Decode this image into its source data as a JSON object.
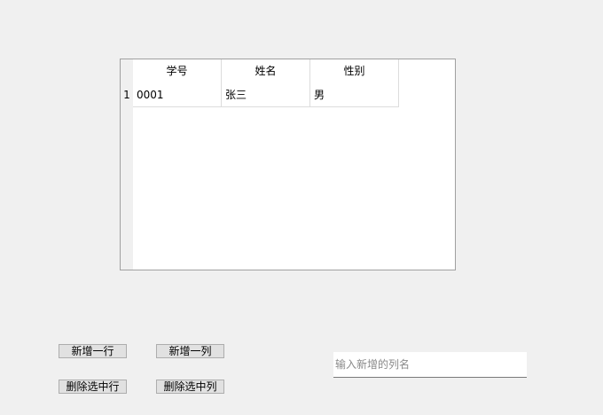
{
  "table": {
    "columns": [
      "学号",
      "姓名",
      "性别"
    ],
    "row_headers": [
      "1"
    ],
    "rows": [
      [
        "0001",
        "张三",
        "男"
      ]
    ]
  },
  "buttons": {
    "add_row": "新增一行",
    "add_column": "新增一列",
    "delete_row": "删除选中行",
    "delete_column": "删除选中列"
  },
  "column_name_input": {
    "value": "",
    "placeholder": "输入新增的列名"
  }
}
